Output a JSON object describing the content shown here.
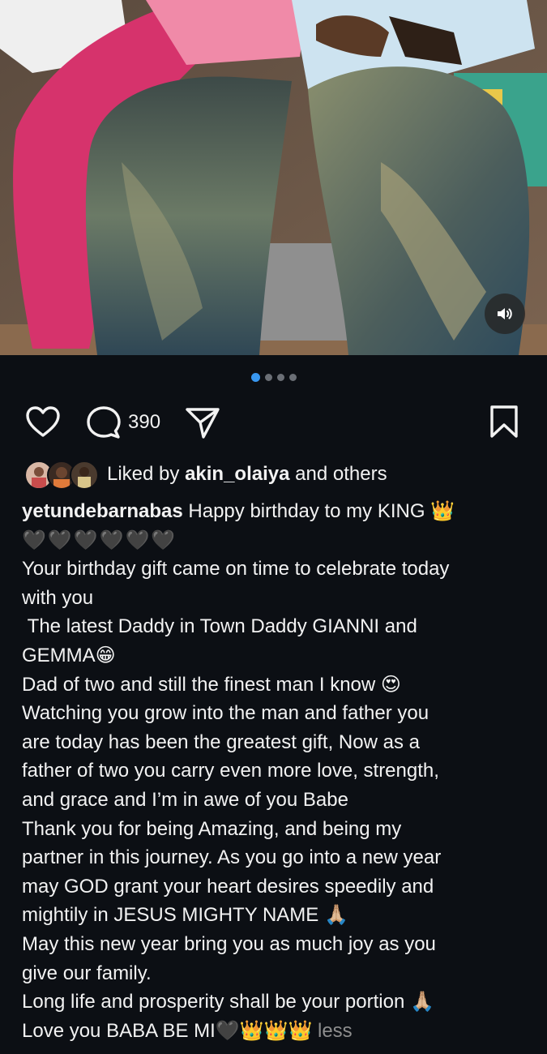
{
  "post": {
    "carousel": {
      "total": 4,
      "active_index": 0
    },
    "audio": {
      "icon": "speaker-icon",
      "state": "on"
    }
  },
  "actions": {
    "like_icon": "heart-icon",
    "comment_icon": "comment-icon",
    "comment_count": "390",
    "share_icon": "send-icon",
    "save_icon": "bookmark-icon"
  },
  "likes": {
    "prefix": "Liked by ",
    "user": "akin_olaiya",
    "suffix": " and others"
  },
  "caption": {
    "username": "yetundebarnabas",
    "line1": " Happy birthday to my KING ",
    "lines": [
      "Your birthday gift came on time to celebrate today",
      "with you",
      " The latest Daddy in Town Daddy GIANNI and",
      "GEMMA",
      "Dad of two and still the finest man I know ",
      "Watching you grow into the man and father you",
      "are today has been the greatest gift, Now as a",
      "father of two you carry even more love, strength,",
      "and grace and I’m in awe of you Babe",
      "Thank you for being Amazing, and being my",
      "partner in this journey. As you go into a new year",
      "may GOD grant your heart desires speedily and",
      "mightily in JESUS MIGHTY NAME ",
      "May this new year bring you as much joy as you",
      "give our family.",
      "Long life and prosperity shall be your portion ",
      "Love you BABA BE MI"
    ],
    "less_label": "less"
  },
  "colors": {
    "background": "#0c0f14",
    "text": "#f2f2f2",
    "muted": "#8e8e8e",
    "accent_dot": "#3897f0"
  }
}
